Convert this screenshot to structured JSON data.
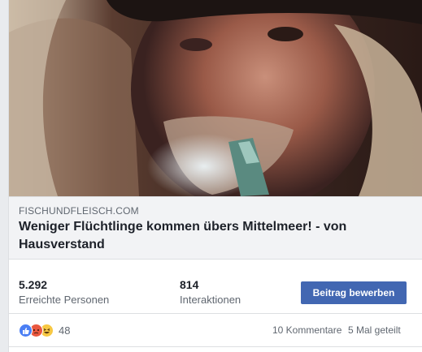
{
  "post": {
    "image_alt": "",
    "link": {
      "domain": "FISCHUNDFLEISCH.COM",
      "headline": "Weniger Flüchtlinge kommen übers Mittelmeer! - von Hausverstand"
    },
    "stats": {
      "reach_value": "5.292",
      "reach_label": "Erreichte Personen",
      "engagement_value": "814",
      "engagement_label": "Interaktionen",
      "boost_label": "Beitrag bewerben"
    },
    "reactions": {
      "icons": [
        "like-icon",
        "angry-icon",
        "haha-icon"
      ],
      "count": "48"
    },
    "comments_label": "10 Kommentare",
    "shares_label": "5 Mal geteilt"
  },
  "colors": {
    "accent": "#4267b2",
    "text": "#1d2129",
    "secondary": "#606770",
    "like": "#4a7ef4",
    "angry": "#e9573f",
    "haha": "#f7c843"
  }
}
